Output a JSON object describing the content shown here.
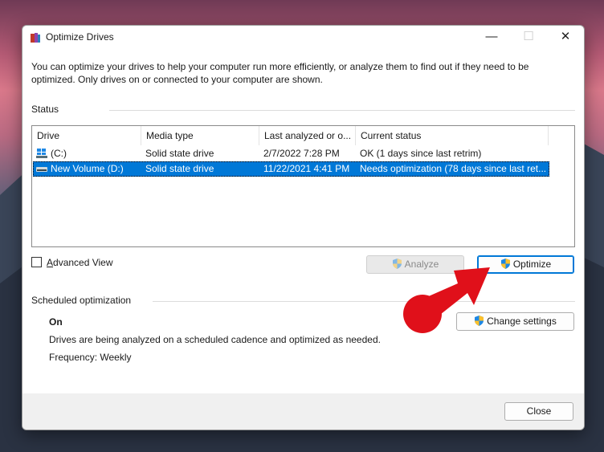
{
  "window": {
    "title": "Optimize Drives",
    "intro": "You can optimize your drives to help your computer run more efficiently, or analyze them to find out if they need to be optimized. Only drives on or connected to your computer are shown."
  },
  "status_section": {
    "label": "Status",
    "columns": [
      "Drive",
      "Media type",
      "Last analyzed or o...",
      "Current status"
    ],
    "rows": [
      {
        "drive": "(C:)",
        "media": "Solid state drive",
        "last": "2/7/2022 7:28 PM",
        "status": "OK (1 days since last retrim)",
        "icon": "windows-drive-icon",
        "selected": false
      },
      {
        "drive": "New Volume (D:)",
        "media": "Solid state drive",
        "last": "11/22/2021 4:41 PM",
        "status": "Needs optimization (78 days since last ret...",
        "icon": "drive-icon",
        "selected": true
      }
    ]
  },
  "advanced_view": {
    "label": "Advanced View",
    "checked": false
  },
  "buttons": {
    "analyze": "Analyze",
    "optimize": "Optimize",
    "change_settings": "Change settings",
    "close": "Close"
  },
  "scheduled": {
    "label": "Scheduled optimization",
    "state": "On",
    "description": "Drives are being analyzed on a scheduled cadence and optimized as needed.",
    "frequency": "Frequency: Weekly"
  },
  "colors": {
    "selection": "#0078d7",
    "annotation_arrow": "#e0101a"
  }
}
